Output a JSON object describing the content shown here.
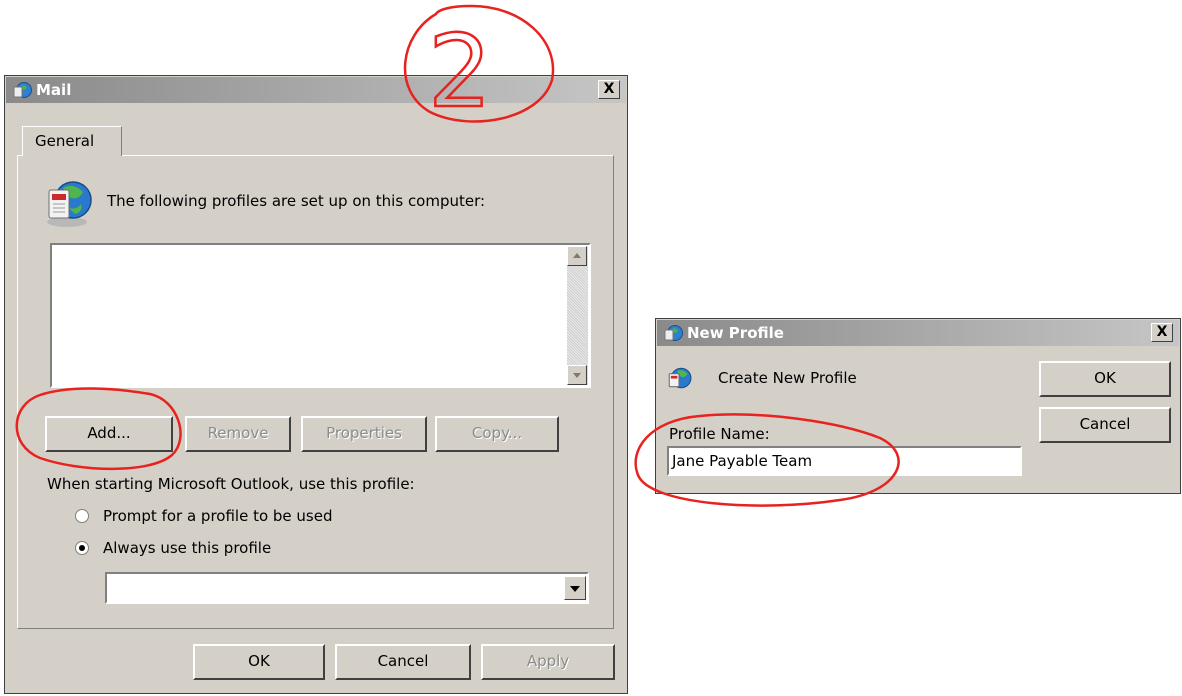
{
  "mail_dialog": {
    "title": "Mail",
    "close_label": "X",
    "tab_general": "General",
    "profiles_caption": "The following profiles are set up on this computer:",
    "buttons": {
      "add": "Add...",
      "remove": "Remove",
      "properties": "Properties",
      "copy": "Copy..."
    },
    "startup_caption": "When starting Microsoft Outlook, use this profile:",
    "radio_prompt": "Prompt for a profile to be used",
    "radio_always": "Always use this profile",
    "radio_selected": "always",
    "profile_select_value": "",
    "footer": {
      "ok": "OK",
      "cancel": "Cancel",
      "apply": "Apply"
    }
  },
  "new_profile_dialog": {
    "title": "New Profile",
    "close_label": "X",
    "heading": "Create New Profile",
    "profile_name_label": "Profile Name:",
    "profile_name_value": "Jane Payable Team",
    "ok": "OK",
    "cancel": "Cancel"
  },
  "annotation": {
    "step_number": "2",
    "color": "#e8221e"
  },
  "colors": {
    "dialog_face": "#d4d0c8",
    "title_gradient_start": "#8a8a8a",
    "title_gradient_end": "#c6c6c6"
  }
}
